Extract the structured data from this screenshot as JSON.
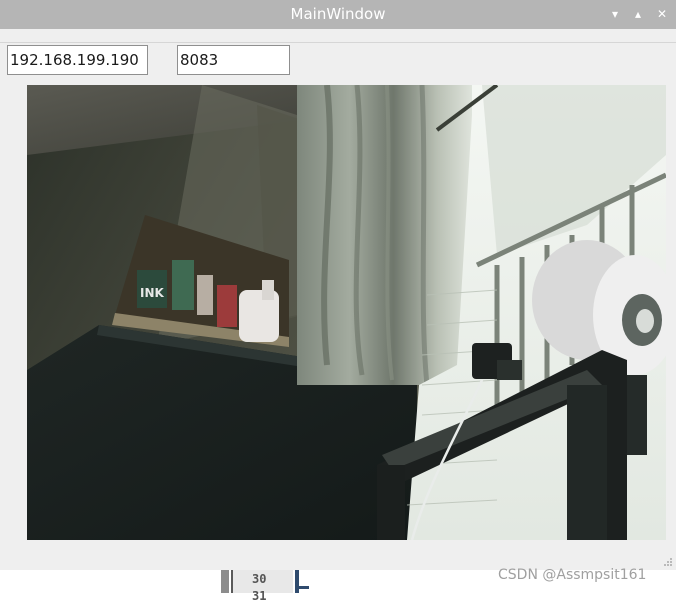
{
  "window": {
    "title": "MainWindow",
    "controls": {
      "minimize": "▾",
      "maximize": "▴",
      "close": "✕"
    }
  },
  "inputs": {
    "ip": {
      "value": "192.168.199.190"
    },
    "port": {
      "value": "8083"
    }
  },
  "editor_strip": {
    "line_number": "30",
    "line_number_next": "31"
  },
  "watermark": "CSDN @Assmpsit161",
  "icons": {
    "minimize": "chevron-down-icon",
    "maximize": "chevron-up-icon",
    "close": "close-icon",
    "resize": "resize-grip-icon"
  },
  "colors": {
    "titlebar": "#b5b5b5",
    "client_bg": "#efefef"
  }
}
